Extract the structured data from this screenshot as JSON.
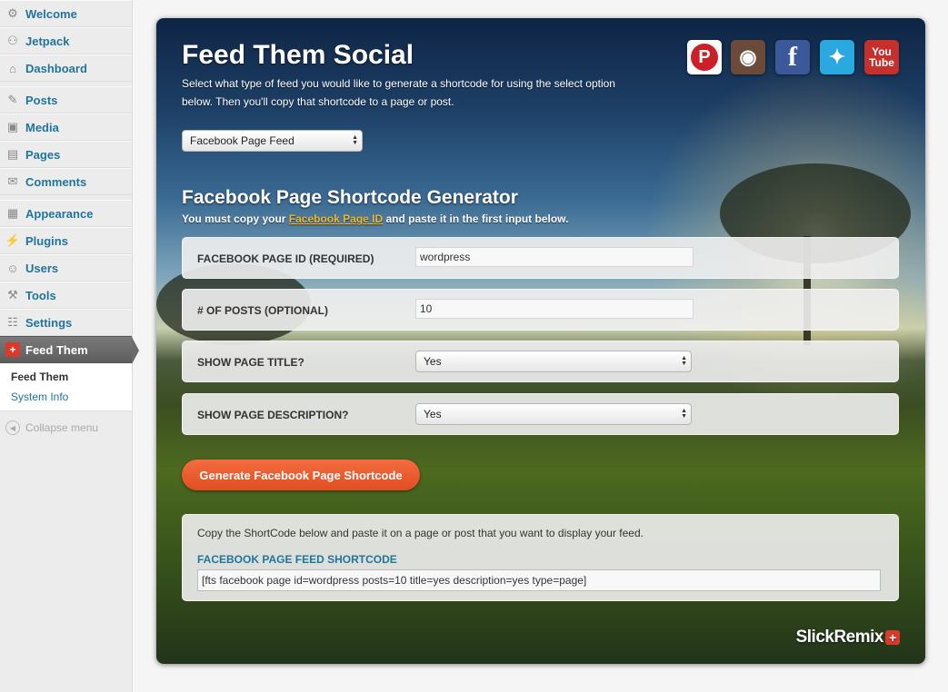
{
  "sidebar": {
    "items": [
      {
        "label": "Welcome",
        "icon": "⚙"
      },
      {
        "label": "Jetpack",
        "icon": "⚇"
      },
      {
        "label": "Dashboard",
        "icon": "⌂"
      },
      {
        "label": "Posts",
        "icon": "✎"
      },
      {
        "label": "Media",
        "icon": "▣"
      },
      {
        "label": "Pages",
        "icon": "▤"
      },
      {
        "label": "Comments",
        "icon": "✉"
      },
      {
        "label": "Appearance",
        "icon": "▦"
      },
      {
        "label": "Plugins",
        "icon": "⚡"
      },
      {
        "label": "Users",
        "icon": "☺"
      },
      {
        "label": "Tools",
        "icon": "⚒"
      },
      {
        "label": "Settings",
        "icon": "☷"
      },
      {
        "label": "Feed Them",
        "icon": "+"
      }
    ],
    "submenu": [
      "Feed Them",
      "System Info"
    ],
    "collapse_label": "Collapse menu"
  },
  "panel": {
    "title": "Feed Them Social",
    "intro": "Select what type of feed you would like to generate a shortcode for using the select option below. Then you'll copy that shortcode to a page or post.",
    "social_icons": [
      {
        "name": "pinterest-icon",
        "glyph": "P",
        "color": "#cb2027"
      },
      {
        "name": "instagram-icon",
        "glyph": "◉",
        "color": "#6b4a3a"
      },
      {
        "name": "facebook-icon",
        "glyph": "f",
        "color": "#3b5998"
      },
      {
        "name": "twitter-icon",
        "glyph": "✦",
        "color": "#2aa9e0"
      },
      {
        "name": "youtube-icon",
        "glyph": "You Tube",
        "color": "#c4302b"
      }
    ],
    "feed_select": "Facebook Page Feed",
    "generator_title": "Facebook Page Shortcode Generator",
    "generator_sub_pre": "You must copy your ",
    "generator_sub_link": "Facebook Page ID",
    "generator_sub_post": " and paste it in the first input below.",
    "fields": [
      {
        "label": "FACEBOOK PAGE ID (REQUIRED)",
        "value": "wordpress"
      },
      {
        "label": "# OF POSTS (OPTIONAL)",
        "value": "10"
      },
      {
        "label": "SHOW PAGE TITLE?",
        "value": "Yes"
      },
      {
        "label": "SHOW PAGE DESCRIPTION?",
        "value": "Yes"
      }
    ],
    "generate_button": "Generate Facebook Page Shortcode",
    "copy_text": "Copy the ShortCode below and paste it on a page or post that you want to display your feed.",
    "shortcode_label": "FACEBOOK PAGE FEED SHORTCODE",
    "shortcode_value": "[fts facebook page id=wordpress posts=10 title=yes description=yes type=page]",
    "brand": "SlickRemix"
  }
}
